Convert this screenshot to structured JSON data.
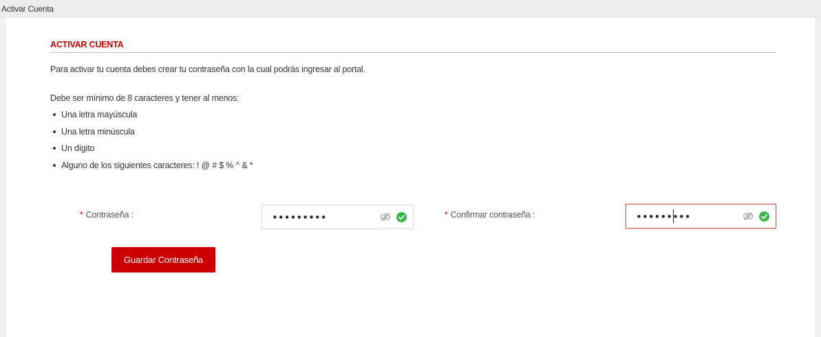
{
  "breadcrumb": "Activar Cuenta",
  "section": {
    "title": "ACTIVAR CUENTA",
    "intro": "Para activar tu cuenta debes crear tu contraseña con la cual podrás ingresar al portal.",
    "requirements_lead": "Debe ser mínimo de 8 caracteres y tener al menos:",
    "requirements": [
      "Una letra mayúscula",
      "Una letra minúscula",
      "Un dígito",
      "Alguno de los siguientes caracteres: ! @ # $ % ^ & *"
    ]
  },
  "form": {
    "password": {
      "required_mark": "*",
      "label": "Contraseña :",
      "masked_value": "•••••••••",
      "visibility_icon": "eye-slash-icon",
      "status_icon": "check-circle-icon"
    },
    "confirm_password": {
      "required_mark": "*",
      "label": "Confirmar contraseña :",
      "masked_value": "•••••••••",
      "visibility_icon": "eye-slash-icon",
      "status_icon": "check-circle-icon"
    },
    "save_label": "Guardar Contraseña"
  },
  "colors": {
    "accent": "#cc0000",
    "success": "#3bb54a",
    "error_border": "#d9534f"
  }
}
